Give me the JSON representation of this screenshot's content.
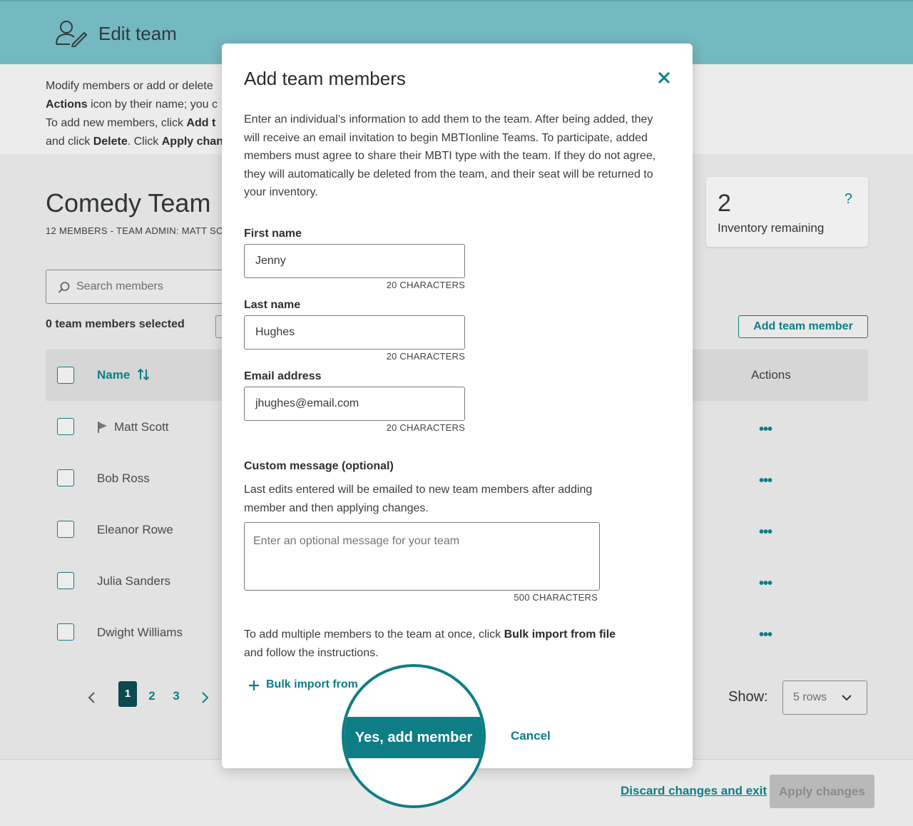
{
  "header": {
    "title": "Edit team",
    "icon": "user-edit-icon"
  },
  "intro": {
    "line1": "Modify members or add or delete",
    "line2_bold": "Actions",
    "line2_rest": " icon by their name; you c",
    "line3_pre": "To add new members, click ",
    "line3_bold": "Add t",
    "line4_pre": "and click ",
    "line4_bold1": "Delete",
    "line4_mid": ". Click ",
    "line4_bold2": "Apply chan"
  },
  "team": {
    "title": "Comedy Team",
    "meta": "12 MEMBERS - TEAM ADMIN: MATT SC"
  },
  "inventory": {
    "count": "2",
    "label": "Inventory remaining",
    "help": "?"
  },
  "search": {
    "placeholder": "Search members"
  },
  "selection": {
    "label": "0 team members selected"
  },
  "add_member_button": "Add team member",
  "table": {
    "col_name": "Name",
    "col_actions": "Actions",
    "rows": [
      {
        "name": "Matt Scott",
        "admin": true
      },
      {
        "name": "Bob Ross"
      },
      {
        "name": "Eleanor Rowe"
      },
      {
        "name": "Julia Sanders"
      },
      {
        "name": "Dwight Williams"
      }
    ],
    "actions_glyph": "•••"
  },
  "pagination": {
    "current": "1",
    "pages": [
      "2",
      "3"
    ]
  },
  "show": {
    "label": "Show:",
    "value": "5 rows"
  },
  "footer": {
    "discard": "Discard changes and exit",
    "apply": "Apply changes"
  },
  "modal": {
    "title": "Add team members",
    "description": "Enter an individual’s information to add them to the team. After being added, they will receive an email invitation to begin MBTIonline Teams. To participate, added members must agree to share their MBTI type with the team. If they do not agree, they will automatically be deleted from the team, and their seat will be returned to your inventory.",
    "first_name": {
      "label": "First name",
      "value": "Jenny",
      "count": "20 CHARACTERS"
    },
    "last_name": {
      "label": "Last name",
      "value": "Hughes",
      "count": "20 CHARACTERS"
    },
    "email": {
      "label": "Email address",
      "value": "jhughes@email.com",
      "count": "20 CHARACTERS"
    },
    "custom_message": {
      "label": "Custom message (optional)",
      "description": "Last edits entered will be emailed to new team members after adding member and then applying changes.",
      "placeholder": "Enter an optional message for your team",
      "count": "500 CHARACTERS"
    },
    "bulk_text_pre": "To add multiple members to the team at once, click ",
    "bulk_text_bold": "Bulk import from file",
    "bulk_text_post": " and follow the instructions.",
    "bulk_link": "Bulk import from",
    "confirm": "Yes, add member",
    "cancel": "Cancel"
  },
  "colors": {
    "accent": "#0e7d86",
    "header_bg": "#74b8c0"
  }
}
